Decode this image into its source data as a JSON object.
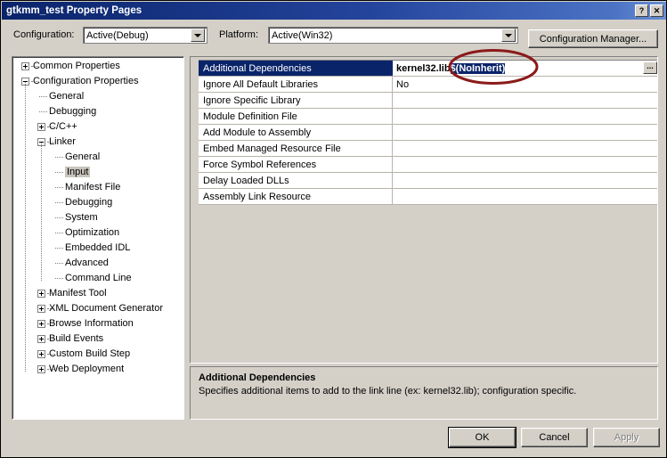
{
  "window": {
    "title": "gtkmm_test Property Pages",
    "help_button": "?",
    "close_button": "✕",
    "titlebar_color": "#0a246a",
    "dialog_bg": "#d4d0c8"
  },
  "toolbar": {
    "configuration_label": "Configuration:",
    "configuration_value": "Active(Debug)",
    "platform_label": "Platform:",
    "platform_value": "Active(Win32)",
    "configuration_manager_label": "Configuration Manager..."
  },
  "tree": {
    "items": [
      {
        "label": "Common Properties",
        "level": 0,
        "expander": "plus",
        "selected": false
      },
      {
        "label": "Configuration Properties",
        "level": 0,
        "expander": "minus",
        "selected": false
      },
      {
        "label": "General",
        "level": 1,
        "expander": "none",
        "selected": false
      },
      {
        "label": "Debugging",
        "level": 1,
        "expander": "none",
        "selected": false
      },
      {
        "label": "C/C++",
        "level": 1,
        "expander": "plus",
        "selected": false
      },
      {
        "label": "Linker",
        "level": 1,
        "expander": "minus",
        "selected": false
      },
      {
        "label": "General",
        "level": 2,
        "expander": "none",
        "selected": false
      },
      {
        "label": "Input",
        "level": 2,
        "expander": "none",
        "selected": true
      },
      {
        "label": "Manifest File",
        "level": 2,
        "expander": "none",
        "selected": false
      },
      {
        "label": "Debugging",
        "level": 2,
        "expander": "none",
        "selected": false
      },
      {
        "label": "System",
        "level": 2,
        "expander": "none",
        "selected": false
      },
      {
        "label": "Optimization",
        "level": 2,
        "expander": "none",
        "selected": false
      },
      {
        "label": "Embedded IDL",
        "level": 2,
        "expander": "none",
        "selected": false
      },
      {
        "label": "Advanced",
        "level": 2,
        "expander": "none",
        "selected": false
      },
      {
        "label": "Command Line",
        "level": 2,
        "expander": "none",
        "selected": false
      },
      {
        "label": "Manifest Tool",
        "level": 1,
        "expander": "plus",
        "selected": false
      },
      {
        "label": "XML Document Generator",
        "level": 1,
        "expander": "plus",
        "selected": false
      },
      {
        "label": "Browse Information",
        "level": 1,
        "expander": "plus",
        "selected": false
      },
      {
        "label": "Build Events",
        "level": 1,
        "expander": "plus",
        "selected": false
      },
      {
        "label": "Custom Build Step",
        "level": 1,
        "expander": "plus",
        "selected": false
      },
      {
        "label": "Web Deployment",
        "level": 1,
        "expander": "plus",
        "selected": false
      }
    ]
  },
  "grid": {
    "rows": [
      {
        "name": "Additional Dependencies",
        "value": "kernel32.lib ",
        "value_selected": "$(NoInherit)",
        "selected": true,
        "has_ellipsis": true
      },
      {
        "name": "Ignore All Default Libraries",
        "value": "No",
        "value_selected": "",
        "selected": false,
        "has_ellipsis": false
      },
      {
        "name": "Ignore Specific Library",
        "value": "",
        "value_selected": "",
        "selected": false,
        "has_ellipsis": false
      },
      {
        "name": "Module Definition File",
        "value": "",
        "value_selected": "",
        "selected": false,
        "has_ellipsis": false
      },
      {
        "name": "Add Module to Assembly",
        "value": "",
        "value_selected": "",
        "selected": false,
        "has_ellipsis": false
      },
      {
        "name": "Embed Managed Resource File",
        "value": "",
        "value_selected": "",
        "selected": false,
        "has_ellipsis": false
      },
      {
        "name": "Force Symbol References",
        "value": "",
        "value_selected": "",
        "selected": false,
        "has_ellipsis": false
      },
      {
        "name": "Delay Loaded DLLs",
        "value": "",
        "value_selected": "",
        "selected": false,
        "has_ellipsis": false
      },
      {
        "name": "Assembly Link Resource",
        "value": "",
        "value_selected": "",
        "selected": false,
        "has_ellipsis": false
      }
    ],
    "ellipsis_label": "..."
  },
  "description": {
    "title": "Additional Dependencies",
    "body": "Specifies additional items to add to the link line (ex: kernel32.lib); configuration specific."
  },
  "buttons": {
    "ok": "OK",
    "cancel": "Cancel",
    "apply": "Apply"
  },
  "annotation": {
    "color": "#8b1a1a",
    "shape": "ellipse"
  }
}
